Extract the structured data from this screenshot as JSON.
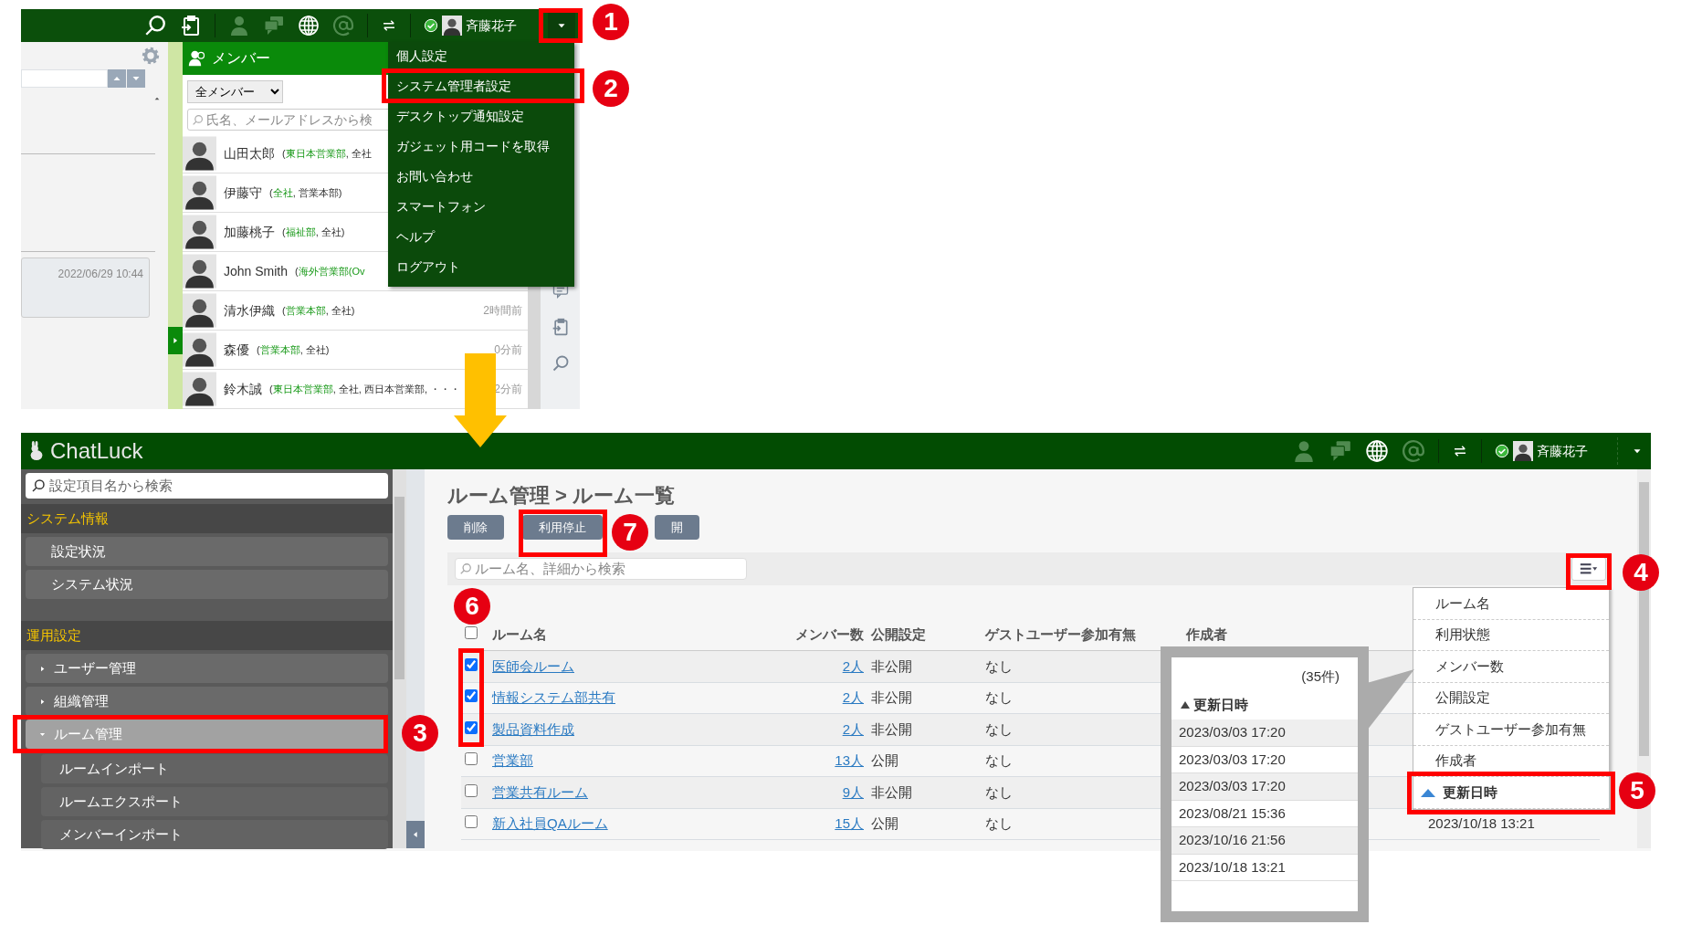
{
  "top_screen": {
    "user_name": "斉藤花子",
    "left_pane": {
      "timestamp": "2022/06/29 10:44"
    },
    "member_panel": {
      "title": "メンバー",
      "filter": "全メンバー",
      "search_placeholder": "氏名、メールアドレスから検",
      "members": [
        {
          "name": "山田太郎",
          "affiliation": [
            {
              "text": "(",
              "highlight": false
            },
            {
              "text": "東日本営業部",
              "highlight": true
            },
            {
              "text": ", 全社",
              "highlight": false
            }
          ]
        },
        {
          "name": "伊藤守",
          "affiliation": [
            {
              "text": "(",
              "highlight": false
            },
            {
              "text": "全社",
              "highlight": true
            },
            {
              "text": ", 営業本部)",
              "highlight": false
            }
          ]
        },
        {
          "name": "加藤桃子",
          "affiliation": [
            {
              "text": "(",
              "highlight": false
            },
            {
              "text": "福祉部",
              "highlight": true
            },
            {
              "text": ", 全社)",
              "highlight": false
            }
          ]
        },
        {
          "name": "John Smith",
          "affiliation": [
            {
              "text": "(",
              "highlight": false
            },
            {
              "text": "海外営業部(Ov",
              "highlight": true
            }
          ]
        },
        {
          "name": "清水伊織",
          "affiliation": [
            {
              "text": "(",
              "highlight": false
            },
            {
              "text": "営業本部",
              "highlight": true
            },
            {
              "text": ", 全社)",
              "highlight": false
            }
          ],
          "time": "2時間前"
        },
        {
          "name": "森優",
          "affiliation": [
            {
              "text": "(",
              "highlight": false
            },
            {
              "text": "営業本部",
              "highlight": true
            },
            {
              "text": ", 全社)",
              "highlight": false
            }
          ],
          "time": "0分前"
        },
        {
          "name": "鈴木誠",
          "affiliation": [
            {
              "text": "(",
              "highlight": false
            },
            {
              "text": "東日本営業部",
              "highlight": true
            },
            {
              "text": ", 全社, 西日本営業部, ・・・",
              "highlight": false
            }
          ],
          "time": "2分前"
        }
      ]
    },
    "menu": [
      "個人設定",
      "システム管理者設定",
      "デスクトップ通知設定",
      "ガジェット用コードを取得",
      "お問い合わせ",
      "スマートフォン",
      "ヘルプ",
      "ログアウト"
    ]
  },
  "bottom_screen": {
    "logo": "ChatLuck",
    "user_name": "斉藤花子",
    "sidebar_search_placeholder": "設定項目名から検索",
    "sidebar": [
      {
        "title": "システム情報",
        "items": [
          {
            "label": "設定状況"
          },
          {
            "label": "システム状況"
          }
        ]
      },
      {
        "title": "運用設定",
        "items": [
          {
            "label": "ユーザー管理",
            "expanded": false,
            "selected": false
          },
          {
            "label": "組織管理",
            "expanded": false,
            "selected": false
          },
          {
            "label": "ルーム管理",
            "expanded": true,
            "selected": true,
            "children": [
              {
                "label": "ルームインポート"
              },
              {
                "label": "ルームエクスポート"
              },
              {
                "label": "メンバーインポート"
              }
            ]
          }
        ]
      }
    ],
    "page_title": "ルーム管理 > ルーム一覧",
    "actions": [
      "削除",
      "利用停止",
      "開"
    ],
    "search_placeholder": "ルーム名、詳細から検索",
    "table": {
      "all_checked": false,
      "columns": [
        "ルーム名",
        "メンバー数",
        "公開設定",
        "ゲストユーザー参加有無",
        "作成者"
      ],
      "rows": [
        {
          "checked": true,
          "name": "医師会ルーム",
          "members": "2人",
          "visibility": "非公開",
          "guest": "なし"
        },
        {
          "checked": true,
          "name": "情報システム部共有",
          "members": "2人",
          "visibility": "非公開",
          "guest": "なし"
        },
        {
          "checked": true,
          "name": "製品資料作成",
          "members": "2人",
          "visibility": "非公開",
          "guest": "なし"
        },
        {
          "checked": false,
          "name": "営業部",
          "members": "13人",
          "visibility": "公開",
          "guest": "なし"
        },
        {
          "checked": false,
          "name": "営業共有ルーム",
          "members": "9人",
          "visibility": "非公開",
          "guest": "なし"
        },
        {
          "checked": false,
          "name": "新入社員QAルーム",
          "members": "15人",
          "visibility": "公開",
          "guest": "なし",
          "updated": "2023/10/18 13:21"
        }
      ]
    },
    "column_menu": [
      {
        "label": "ルーム名",
        "sorted": false
      },
      {
        "label": "利用状態",
        "sorted": false
      },
      {
        "label": "メンバー数",
        "sorted": false
      },
      {
        "label": "公開設定",
        "sorted": false
      },
      {
        "label": "ゲストユーザー参加有無",
        "sorted": false
      },
      {
        "label": "作成者",
        "sorted": false
      },
      {
        "label": "更新日時",
        "sorted": true
      }
    ]
  },
  "callout": {
    "count": "(35件)",
    "sort_label": "更新日時",
    "values": [
      "2023/03/03 17:20",
      "2023/03/03 17:20",
      "2023/03/03 17:20",
      "2023/08/21 15:36",
      "2023/10/16 21:56",
      "2023/10/18 13:21"
    ]
  },
  "annotations": [
    "1",
    "2",
    "3",
    "4",
    "5",
    "6",
    "7"
  ]
}
